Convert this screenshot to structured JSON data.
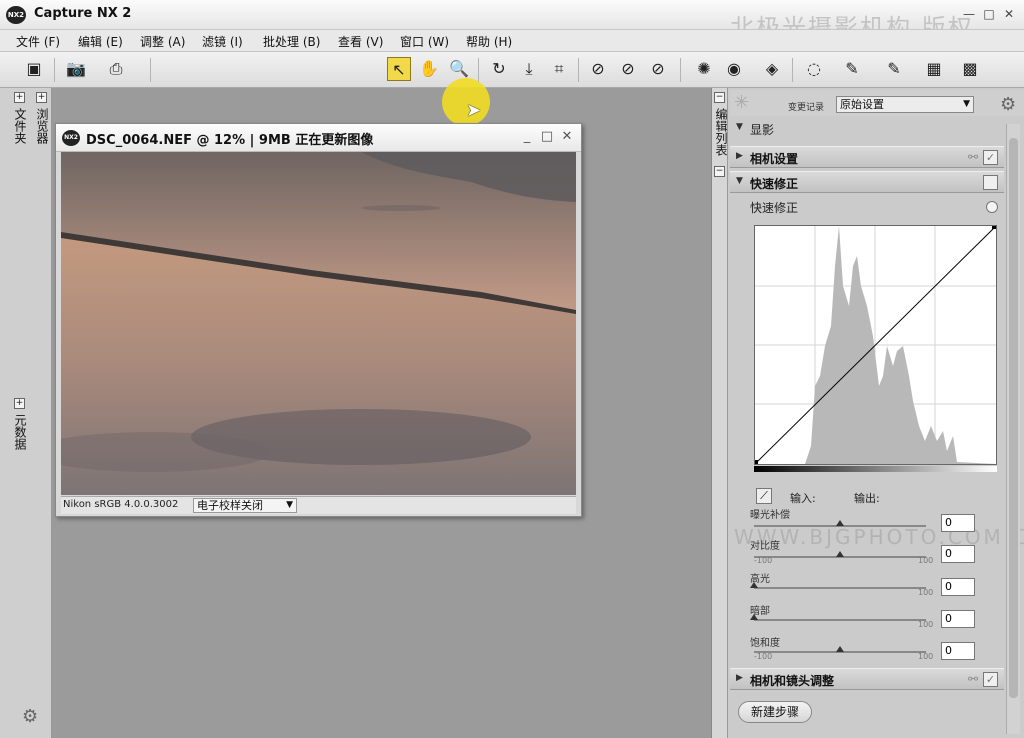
{
  "app": {
    "logo": "NX2",
    "title": "Capture NX 2",
    "watermark": "北极光摄影机构 版权",
    "window_controls": [
      "minimize-icon",
      "maximize-icon",
      "close-icon"
    ]
  },
  "menu": [
    "文件 (F)",
    "编辑 (E)",
    "调整 (A)",
    "滤镜 (I)",
    "批处理 (B)",
    "查看 (V)",
    "窗口 (W)",
    "帮助 (H)"
  ],
  "toolbar": {
    "tools": [
      {
        "name": "browser-toggle-icon",
        "glyph": "▣"
      },
      {
        "name": "camera-icon",
        "glyph": "📷"
      },
      {
        "name": "print-icon",
        "glyph": "⎙"
      },
      {
        "name": "direct-select-arrow-icon",
        "glyph": "↖"
      },
      {
        "name": "hand-icon",
        "glyph": "✋"
      },
      {
        "name": "zoom-icon",
        "glyph": "🔍"
      },
      {
        "name": "rotate-icon",
        "glyph": "↻"
      },
      {
        "name": "straighten-icon",
        "glyph": "⤓"
      },
      {
        "name": "crop-icon",
        "glyph": "⌗"
      },
      {
        "name": "black-point-icon",
        "glyph": "⊘"
      },
      {
        "name": "neutral-point-icon",
        "glyph": "⊘"
      },
      {
        "name": "white-point-icon",
        "glyph": "⊘"
      },
      {
        "name": "red-eye-icon",
        "glyph": "✺"
      },
      {
        "name": "auto-retouch-icon",
        "glyph": "◉"
      },
      {
        "name": "color-control-point-icon",
        "glyph": "◈"
      },
      {
        "name": "lasso-icon",
        "glyph": "◌"
      },
      {
        "name": "brush-icon",
        "glyph": "✎"
      },
      {
        "name": "gradient-icon",
        "glyph": "▦"
      },
      {
        "name": "fill-icon",
        "glyph": "▩"
      }
    ]
  },
  "left_dock": {
    "tab_folder": "文件夹",
    "tab_browser": "浏览器",
    "tab_metadata": "元数据",
    "plus": "+",
    "gear": "⚙"
  },
  "document": {
    "logo": "NX2",
    "title": "DSC_0064.NEF  @  12%  | 9MB 正在更新图像",
    "profile": "Nikon sRGB 4.0.0.3002",
    "proof_select": "电子校样关闭"
  },
  "edit_list": {
    "tab_label": "编辑列表",
    "history_label": "变更记录",
    "preset": "原始设置",
    "develop": "显影",
    "camera_settings": "相机设置",
    "quick_fix": "快速修正",
    "quick_fix_sub": "快速修正",
    "input_label": "输入:",
    "output_label": "输出:",
    "sliders": [
      {
        "label": "曝光补偿",
        "value": "0",
        "min": "",
        "max": "",
        "position": 0.5
      },
      {
        "label": "对比度",
        "value": "0",
        "min": "-100",
        "max": "100",
        "position": 0.5
      },
      {
        "label": "高光",
        "value": "0",
        "min": "",
        "max": "100",
        "position": 0.0
      },
      {
        "label": "暗部",
        "value": "0",
        "min": "",
        "max": "100",
        "position": 0.0
      },
      {
        "label": "饱和度",
        "value": "0",
        "min": "-100",
        "max": "100",
        "position": 0.5
      }
    ],
    "lens_adjust": "相机和镜头调整",
    "watermark": "WWW.BJGPHOTO.COM.CN",
    "new_step": "新建步骤"
  }
}
